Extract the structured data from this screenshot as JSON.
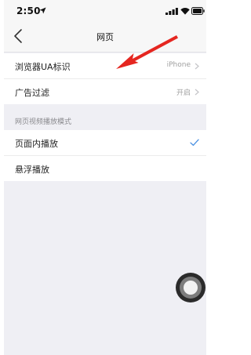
{
  "status_bar": {
    "time": "2:50",
    "icons": [
      "location-arrow-icon",
      "signal-icon",
      "wifi-icon",
      "battery-icon"
    ]
  },
  "nav": {
    "title": "网页",
    "back_icon": "chevron-left-icon"
  },
  "settings": {
    "rows": [
      {
        "label": "浏览器UA标识",
        "value": "iPhone"
      },
      {
        "label": "广告过滤",
        "value": "开启"
      }
    ]
  },
  "video_mode": {
    "header": "网页视频播放模式",
    "options": [
      {
        "label": "页面内播放",
        "selected": true
      },
      {
        "label": "悬浮播放",
        "selected": false
      }
    ]
  },
  "colors": {
    "accent": "#4a90e2",
    "arrow": "#e52620",
    "background": "#efeff4"
  }
}
